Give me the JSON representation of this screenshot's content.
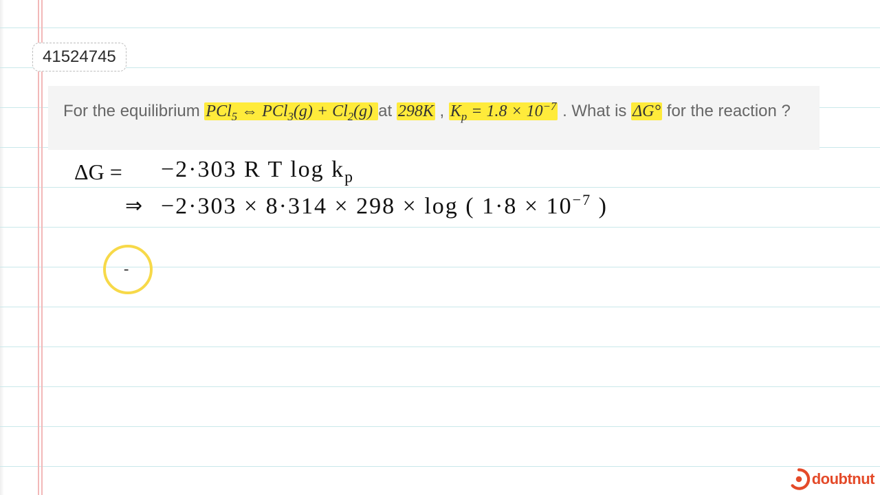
{
  "page_id": "41524745",
  "question": {
    "prefix": "For the equilibrium ",
    "eq_reaction": "PCl₅ ⇔ PCl₃(g) + Cl₂(g)",
    "at": " at ",
    "temp": "298K",
    "comma": ", ",
    "kp_label": "Kₚ = 1.8 × 10",
    "kp_exp": "−7",
    "period": ". What is ",
    "dg": "ΔG°",
    "rest": " for the reaction ?"
  },
  "work": {
    "line1_left": "ΔG =",
    "line1_right": "−2·303 R T  log k",
    "line1_sub": "p",
    "line2_arrow": "⇒",
    "line2_body": "−2·303 × 8·314 × 298   ×  log ( 1·8 × 10",
    "line2_exp": "−7",
    "line2_close": " )",
    "dash": "-"
  },
  "brand": {
    "name": "doubtnut"
  },
  "colors": {
    "highlight": "#ffeb3b",
    "rule": "#c9e8ea",
    "margin": "#f2b8b8",
    "brand": "#e44a29"
  }
}
